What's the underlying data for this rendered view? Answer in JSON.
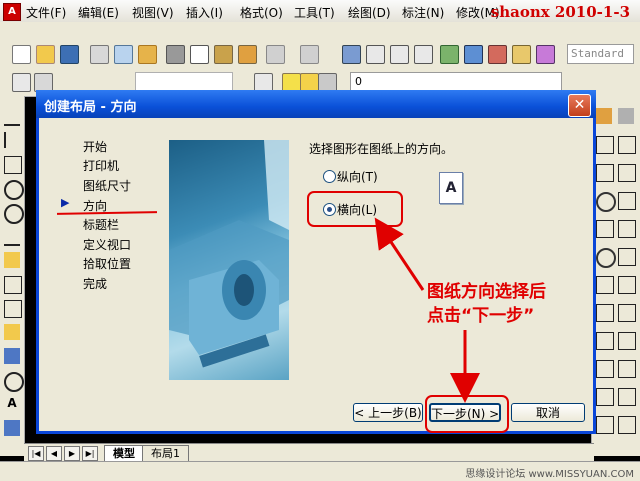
{
  "menubar": {
    "items": [
      "文件(F)",
      "编辑(E)",
      "视图(V)",
      "插入(I)",
      "格式(O)",
      "工具(T)",
      "绘图(D)",
      "标注(N)",
      "修改(M)"
    ],
    "watermark": "shaonx 2010-1-3"
  },
  "toolbar": {
    "style_box": "Standard",
    "layer_value": "0"
  },
  "layout_tabs": {
    "model": "模型",
    "layout1": "布局1"
  },
  "credit": "思缘设计论坛 www.MISSYUAN.COM",
  "dialog": {
    "title": "创建布局 - 方向",
    "close_label": "✕",
    "steps": [
      "开始",
      "打印机",
      "图纸尺寸",
      "方向",
      "标题栏",
      "定义视口",
      "拾取位置",
      "完成"
    ],
    "current_step_index": 3,
    "prompt": "选择图形在图纸上的方向。",
    "options": {
      "portrait": "纵向(T)",
      "landscape": "横向(L)",
      "selected": "landscape"
    },
    "paper_icon_letter": "A",
    "annotation": [
      "图纸方向选择后",
      "点击“下一步”"
    ],
    "buttons": {
      "back": "< 上一步(B)",
      "next": "下一步(N) >",
      "cancel": "取消"
    }
  },
  "colors": {
    "annotation_red": "#e00000",
    "title_blue": "#0a50d8"
  }
}
